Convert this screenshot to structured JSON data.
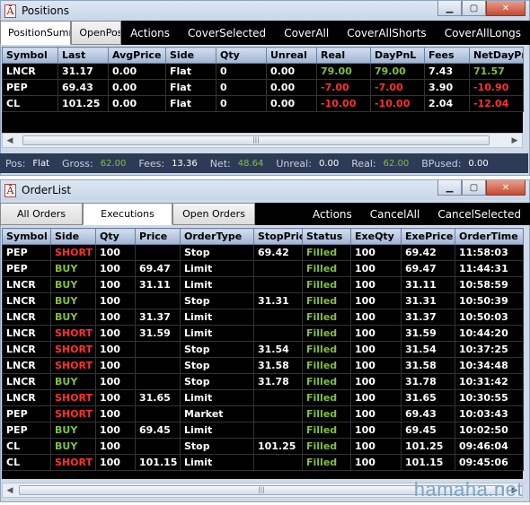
{
  "positions_window": {
    "title": "Positions",
    "tabs": [
      "PositionSummary",
      "OpenPositions"
    ],
    "actions": [
      "Actions",
      "CoverSelected",
      "CoverAll",
      "CoverAllShorts",
      "CoverAllLongs"
    ],
    "columns": [
      "Symbol",
      "Last",
      "AvgPrice",
      "Side",
      "Qty",
      "Unreal",
      "Real",
      "DayPnL",
      "Fees",
      "NetDayPnL"
    ],
    "rows": [
      {
        "symbol": "LNCR",
        "last": "31.17",
        "avg": "0.00",
        "side": "Flat",
        "qty": "0",
        "unreal": "0.00",
        "real": "79.00",
        "daypnl": "79.00",
        "fees": "7.43",
        "net": "71.57",
        "sign": "pos"
      },
      {
        "symbol": "PEP",
        "last": "69.43",
        "avg": "0.00",
        "side": "Flat",
        "qty": "0",
        "unreal": "0.00",
        "real": "-7.00",
        "daypnl": "-7.00",
        "fees": "3.90",
        "net": "-10.90",
        "sign": "neg"
      },
      {
        "symbol": "CL",
        "last": "101.25",
        "avg": "0.00",
        "side": "Flat",
        "qty": "0",
        "unreal": "0.00",
        "real": "-10.00",
        "daypnl": "-10.00",
        "fees": "2.04",
        "net": "-12.04",
        "sign": "neg"
      }
    ],
    "status": {
      "pos_label": "Pos:",
      "pos": "Flat",
      "gross_label": "Gross:",
      "gross": "62.00",
      "fees_label": "Fees:",
      "fees": "13.36",
      "net_label": "Net:",
      "net": "48.64",
      "unreal_label": "Unreal:",
      "unreal": "0.00",
      "real_label": "Real:",
      "real": "62.00",
      "bpused_label": "BPused:",
      "bpused": "0.00"
    }
  },
  "orders_window": {
    "title": "OrderList",
    "tabs": [
      "All Orders",
      "Executions",
      "Open Orders"
    ],
    "actions": [
      "Actions",
      "CancelAll",
      "CancelSelected"
    ],
    "columns": [
      "Symbol",
      "Side",
      "Qty",
      "Price",
      "OrderType",
      "StopPrice",
      "Status",
      "ExeQty",
      "ExePrice",
      "OrderTime"
    ],
    "rows": [
      [
        "PEP",
        "SHORT",
        "100",
        "",
        "Stop",
        "69.42",
        "Filled",
        "100",
        "69.42",
        "11:58:03"
      ],
      [
        "PEP",
        "BUY",
        "100",
        "69.47",
        "Limit",
        "",
        "Filled",
        "100",
        "69.47",
        "11:44:31"
      ],
      [
        "LNCR",
        "BUY",
        "100",
        "31.11",
        "Limit",
        "",
        "Filled",
        "100",
        "31.11",
        "10:58:59"
      ],
      [
        "LNCR",
        "BUY",
        "100",
        "",
        "Stop",
        "31.31",
        "Filled",
        "100",
        "31.31",
        "10:50:39"
      ],
      [
        "LNCR",
        "BUY",
        "100",
        "31.37",
        "Limit",
        "",
        "Filled",
        "100",
        "31.37",
        "10:50:03"
      ],
      [
        "LNCR",
        "SHORT",
        "100",
        "31.59",
        "Limit",
        "",
        "Filled",
        "100",
        "31.59",
        "10:44:20"
      ],
      [
        "LNCR",
        "SHORT",
        "100",
        "",
        "Stop",
        "31.54",
        "Filled",
        "100",
        "31.54",
        "10:37:25"
      ],
      [
        "LNCR",
        "SHORT",
        "100",
        "",
        "Stop",
        "31.58",
        "Filled",
        "100",
        "31.58",
        "10:34:48"
      ],
      [
        "LNCR",
        "BUY",
        "100",
        "",
        "Stop",
        "31.78",
        "Filled",
        "100",
        "31.78",
        "10:31:42"
      ],
      [
        "LNCR",
        "SHORT",
        "100",
        "31.65",
        "Limit",
        "",
        "Filled",
        "100",
        "31.65",
        "10:30:55"
      ],
      [
        "PEP",
        "SHORT",
        "100",
        "",
        "Market",
        "",
        "Filled",
        "100",
        "69.43",
        "10:03:43"
      ],
      [
        "PEP",
        "BUY",
        "100",
        "69.45",
        "Limit",
        "",
        "Filled",
        "100",
        "69.45",
        "10:02:50"
      ],
      [
        "CL",
        "BUY",
        "100",
        "",
        "Stop",
        "101.25",
        "Filled",
        "100",
        "101.25",
        "09:46:04"
      ],
      [
        "CL",
        "SHORT",
        "100",
        "101.15",
        "Limit",
        "",
        "Filled",
        "100",
        "101.15",
        "09:45:06"
      ]
    ]
  },
  "colors": {
    "buy": "#80c040",
    "short": "#ff3030",
    "filled": "#80c040",
    "grid_bg": "#000000",
    "status_bar": "#2e3b56"
  },
  "watermark": "hamaha.net"
}
